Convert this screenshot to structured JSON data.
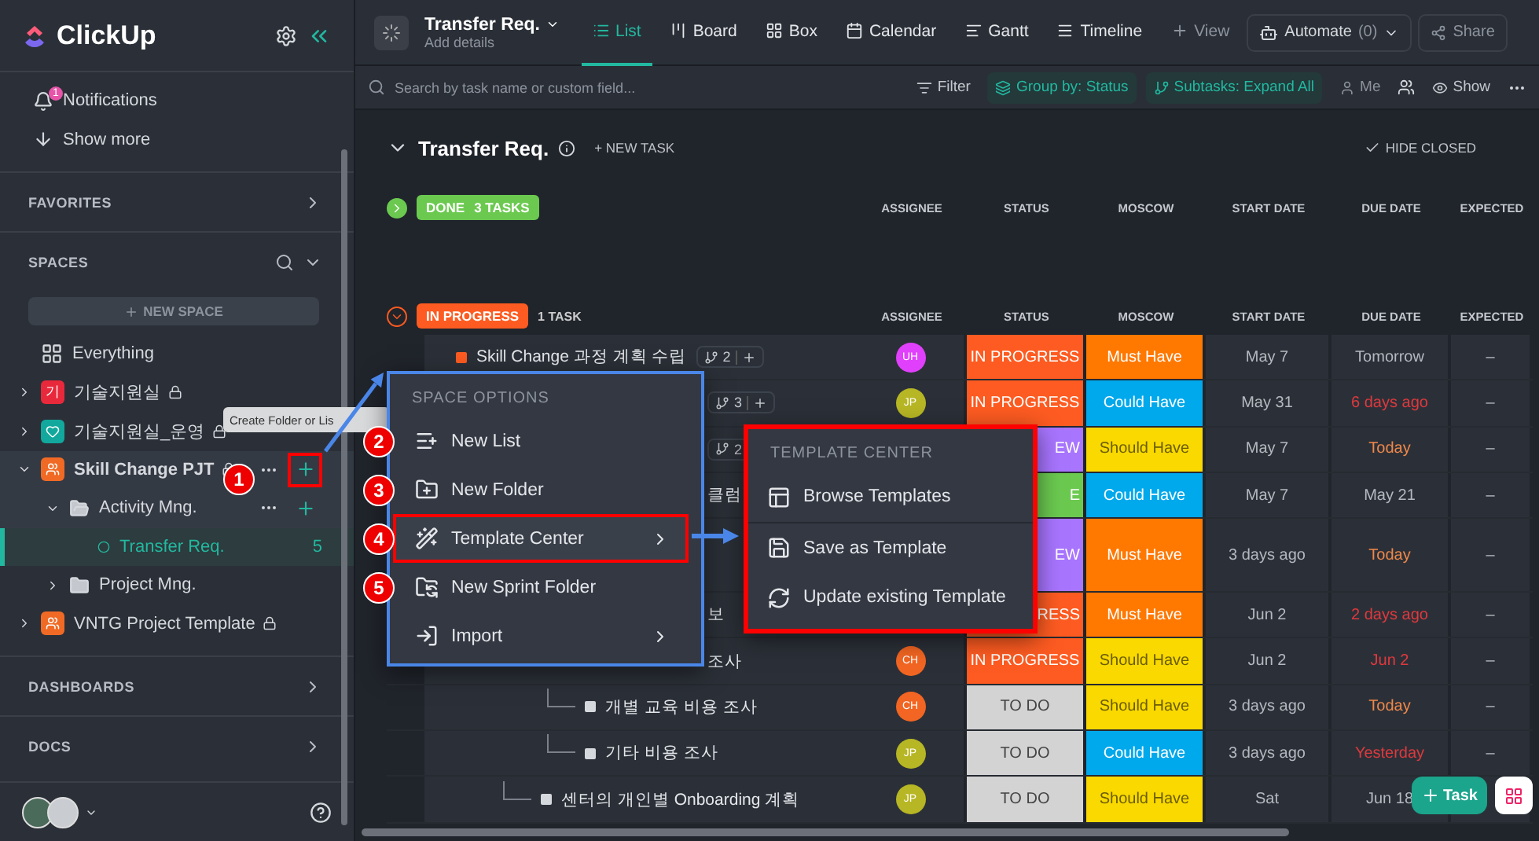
{
  "sidebar": {
    "logo": "ClickUp",
    "notifications": {
      "label": "Notifications",
      "count": "1"
    },
    "show_more": "Show more",
    "favorites": "FAVORITES",
    "spaces_heading": "SPACES",
    "new_space": "NEW SPACE",
    "tree": [
      {
        "label": "Everything",
        "kind": "everything",
        "selected": false,
        "locked": false,
        "hovered": false
      },
      {
        "label": "기술지원실",
        "kind": "space",
        "icon_text": "기",
        "color": "#e8293b",
        "selected": false,
        "locked": true,
        "expanded": false,
        "hovered": false
      },
      {
        "label": "기술지원실_운영",
        "kind": "space",
        "color": "#12a89d",
        "selected": false,
        "locked": true,
        "expanded": false,
        "hovered": false
      },
      {
        "label": "Skill Change PJT",
        "kind": "space",
        "color": "#f06a25",
        "selected": false,
        "locked": true,
        "expanded": true,
        "hovered": true,
        "step": "1",
        "children": [
          {
            "label": "Activity Mng.",
            "kind": "folder",
            "selected": false,
            "locked": false,
            "expanded": true,
            "hovered": true,
            "children": [
              {
                "label": "Transfer Req.",
                "kind": "list",
                "count": "5",
                "selected": true,
                "locked": false,
                "hovered": false
              }
            ]
          },
          {
            "label": "Project Mng.",
            "kind": "folder",
            "selected": false,
            "locked": false,
            "expanded": false,
            "hovered": false
          }
        ]
      },
      {
        "label": "VNTG Project Template",
        "kind": "space",
        "color": "#f06a25",
        "selected": false,
        "locked": true,
        "expanded": false,
        "hovered": false
      }
    ],
    "dashboards": "DASHBOARDS",
    "docs": "DOCS"
  },
  "tooltip": "Create Folder or Lis",
  "header": {
    "title": "Transfer Req.",
    "subtitle": "Add details",
    "views": [
      {
        "label": "List",
        "kind": "list",
        "selected": true
      },
      {
        "label": "Board",
        "kind": "board",
        "selected": false
      },
      {
        "label": "Box",
        "kind": "box",
        "selected": false
      },
      {
        "label": "Calendar",
        "kind": "calendar",
        "selected": false
      },
      {
        "label": "Gantt",
        "kind": "gantt",
        "selected": false
      },
      {
        "label": "Timeline",
        "kind": "timeline",
        "selected": false
      }
    ],
    "add_view": "View",
    "automate": "Automate",
    "automate_count": "(0)",
    "share": "Share"
  },
  "toolbar": {
    "search_placeholder": "Search by task name or custom field...",
    "filter": "Filter",
    "group_by": "Group by: Status",
    "subtasks": "Subtasks: Expand All",
    "me": "Me",
    "show": "Show"
  },
  "list": {
    "title": "Transfer Req.",
    "new_task": "+ NEW TASK",
    "hide_closed": "HIDE CLOSED",
    "groups": [
      {
        "status": "DONE",
        "count": "3 TASKS",
        "color": "#6bc950",
        "expanded": false,
        "columns": [
          "ASSIGNEE",
          "STATUS",
          "MOSCOW",
          "START DATE",
          "DUE DATE",
          "EXPECTED"
        ]
      },
      {
        "status": "IN PROGRESS",
        "count": "1 TASK",
        "color": "#fd5b21",
        "expanded": true,
        "columns": [
          "ASSIGNEE",
          "STATUS",
          "MOSCOW",
          "START DATE",
          "DUE DATE",
          "EXPECTED"
        ],
        "tasks": [
          {
            "name": "Skill Change 과정 계획 수립",
            "covered": false,
            "subtasks": "2",
            "assignee": {
              "initials": "UH",
              "color": "#e040fb"
            },
            "status": {
              "label": "IN PROGRESS",
              "color": "#fd5b21",
              "clipped": false
            },
            "moscow": {
              "label": "Must Have",
              "kind": "must"
            },
            "start": "May 7",
            "due": {
              "text": "Tomorrow",
              "color": "#b4b8bf"
            },
            "expected": "–",
            "children": [
              {
                "covered": true,
                "subtasks": "3",
                "assignee": {
                  "initials": "JP",
                  "color": "#b7b624"
                },
                "status": {
                  "label": "IN PROGRESS",
                  "color": "#fd5b21",
                  "clipped": false
                },
                "moscow": {
                  "label": "Could Have",
                  "kind": "could"
                },
                "start": "May 31",
                "due": {
                  "text": "6 days ago",
                  "color": "#e0393e"
                },
                "expected": "–"
              },
              {
                "covered": true,
                "subtasks": "2",
                "status": {
                  "label": "EW",
                  "color": "#a875ff",
                  "clipped": true
                },
                "moscow": {
                  "label": "Should Have",
                  "kind": "should"
                },
                "start": "May 7",
                "due": {
                  "text": "Today",
                  "color": "#f0884a"
                },
                "expected": "–"
              },
              {
                "name": "클럼",
                "covered": true,
                "status": {
                  "label": "E",
                  "color": "#6bc950",
                  "clipped": true
                },
                "moscow": {
                  "label": "Could Have",
                  "kind": "could"
                },
                "start": "May 7",
                "due": {
                  "text": "May 21",
                  "color": "#b4b8bf"
                },
                "expected": "–"
              },
              {
                "covered": true,
                "status": {
                  "label": "EW",
                  "color": "#a875ff",
                  "clipped": true
                },
                "moscow": {
                  "label": "Must Have",
                  "kind": "must"
                },
                "start": "3 days ago",
                "due": {
                  "text": "Today",
                  "color": "#f0884a"
                },
                "expected": "–"
              },
              {
                "name": "보",
                "covered": true,
                "status": {
                  "label": "RESS",
                  "color": "#fd5b21",
                  "clipped": true
                },
                "moscow": {
                  "label": "Must Have",
                  "kind": "must"
                },
                "start": "Jun 2",
                "due": {
                  "text": "2 days ago",
                  "color": "#e0393e"
                },
                "expected": "–",
                "children": [
                  {
                    "name": "조사",
                    "covered": true,
                    "assignee": {
                      "initials": "CH",
                      "color": "#f26522"
                    },
                    "status": {
                      "label": "IN PROGRESS",
                      "color": "#fd5b21",
                      "clipped": false
                    },
                    "moscow": {
                      "label": "Should Have",
                      "kind": "should"
                    },
                    "start": "Jun 2",
                    "due": {
                      "text": "Jun 2",
                      "color": "#e0393e"
                    },
                    "expected": "–"
                  },
                  {
                    "name": "개별 교육 비용 조사",
                    "covered": false,
                    "assignee": {
                      "initials": "CH",
                      "color": "#f26522"
                    },
                    "status": {
                      "label": "TO DO",
                      "color": "#d3d3d3",
                      "clipped": false
                    },
                    "moscow": {
                      "label": "Should Have",
                      "kind": "should"
                    },
                    "start": "3 days ago",
                    "due": {
                      "text": "Today",
                      "color": "#f0884a"
                    },
                    "expected": "–"
                  },
                  {
                    "name": "기타 비용 조사",
                    "covered": false,
                    "assignee": {
                      "initials": "JP",
                      "color": "#b7b624"
                    },
                    "status": {
                      "label": "TO DO",
                      "color": "#d3d3d3",
                      "clipped": false
                    },
                    "moscow": {
                      "label": "Could Have",
                      "kind": "could"
                    },
                    "start": "3 days ago",
                    "due": {
                      "text": "Yesterday",
                      "color": "#e0393e"
                    },
                    "expected": "–"
                  }
                ]
              },
              {
                "name": "센터의 개인별 Onboarding 계획",
                "covered": false,
                "assignee": {
                  "initials": "JP",
                  "color": "#b7b624"
                },
                "status": {
                  "label": "TO DO",
                  "color": "#d3d3d3",
                  "clipped": false
                },
                "moscow": {
                  "label": "Should Have",
                  "kind": "should"
                },
                "start": "Sat",
                "due": {
                  "text": "Jun 18",
                  "color": "#b4b8bf"
                }
              }
            ]
          }
        ]
      }
    ]
  },
  "space_menu": {
    "title": "SPACE OPTIONS",
    "items": [
      {
        "label": "New List",
        "kind": "new-list",
        "step": "2",
        "submenu": false,
        "selected": false
      },
      {
        "label": "New Folder",
        "kind": "new-folder",
        "step": "3",
        "submenu": false,
        "selected": false
      },
      {
        "label": "Template Center",
        "kind": "template",
        "step": "4",
        "submenu": true,
        "selected": true
      },
      {
        "label": "New Sprint Folder",
        "kind": "sprint",
        "step": "5",
        "submenu": false,
        "selected": false
      },
      {
        "label": "Import",
        "kind": "import",
        "submenu": true,
        "selected": false
      }
    ]
  },
  "template_menu": {
    "title": "TEMPLATE CENTER",
    "items": [
      {
        "label": "Browse Templates",
        "kind": "browse"
      },
      {
        "label": "Save as Template",
        "kind": "save"
      },
      {
        "label": "Update existing Template",
        "kind": "update"
      }
    ]
  },
  "add_task_button": "Task"
}
